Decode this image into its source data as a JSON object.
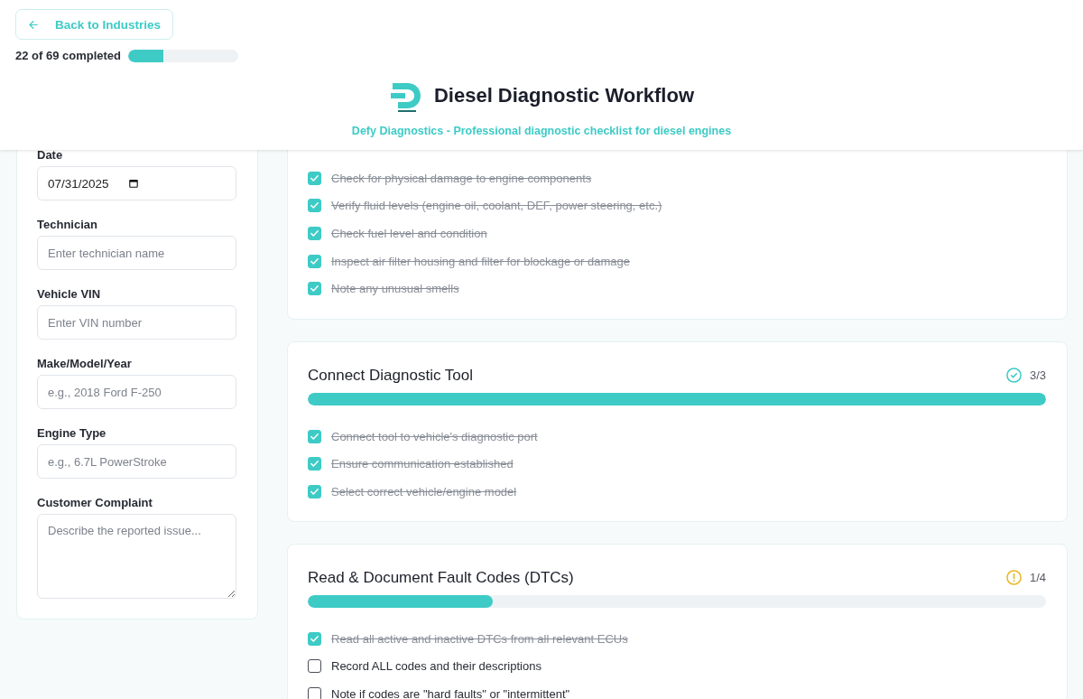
{
  "header": {
    "back_button": "Back to Industries",
    "progress": {
      "label": "22 of 69 completed",
      "level": 0.319
    },
    "title": "Diesel Diagnostic Workflow",
    "subtitle": "Defy Diagnostics - Professional diagnostic checklist for diesel engines"
  },
  "vehicle_form": {
    "fields": [
      {
        "label": "Date",
        "kind": "date",
        "value": "07/31/2025"
      },
      {
        "label": "Technician",
        "kind": "text",
        "placeholder": "Enter technician name"
      },
      {
        "label": "Vehicle VIN",
        "kind": "text",
        "placeholder": "Enter VIN number"
      },
      {
        "label": "Make/Model/Year",
        "kind": "text",
        "placeholder": "e.g., 2018 Ford F-250"
      },
      {
        "label": "Engine Type",
        "kind": "text",
        "placeholder": "e.g., 6.7L PowerStroke"
      },
      {
        "label": "Customer Complaint",
        "kind": "textarea",
        "placeholder": "Describe the reported issue..."
      }
    ]
  },
  "sections": [
    {
      "items": [
        {
          "text": "Check for physical damage to engine components",
          "checked": true
        },
        {
          "text": "Verify fluid levels (engine oil, coolant, DEF, power steering, etc.)",
          "checked": true
        },
        {
          "text": "Check fuel level and condition",
          "checked": true
        },
        {
          "text": "Inspect air filter housing and filter for blockage or damage",
          "checked": true
        },
        {
          "text": "Note any unusual smells",
          "checked": true
        }
      ]
    },
    {
      "title": "Connect Diagnostic Tool",
      "count": "3/3",
      "level": 1,
      "items": [
        {
          "text": "Connect tool to vehicle's diagnostic port",
          "checked": true
        },
        {
          "text": "Ensure communication established",
          "checked": true
        },
        {
          "text": "Select correct vehicle/engine model",
          "checked": true
        }
      ]
    },
    {
      "title": "Read & Document Fault Codes (DTCs)",
      "count": "1/4",
      "level": 0.25,
      "items": [
        {
          "text": "Read all active and inactive DTCs from all relevant ECUs",
          "checked": true
        },
        {
          "text": "Record ALL codes and their descriptions",
          "checked": false
        },
        {
          "text": "Note if codes are \"hard faults\" or \"intermittent\"",
          "checked": false
        }
      ]
    }
  ]
}
